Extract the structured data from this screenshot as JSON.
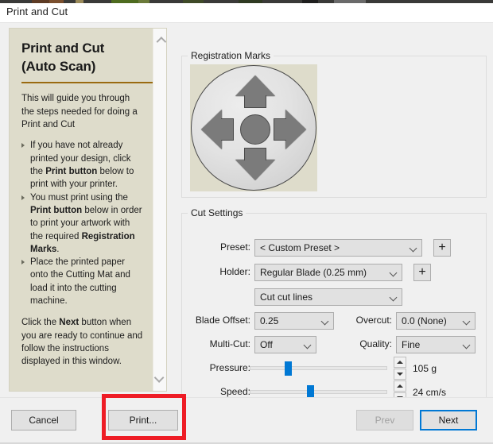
{
  "window": {
    "title": "Print and Cut"
  },
  "left_panel": {
    "heading": "Print and Cut\n(Auto Scan)",
    "heading_line1": "Print and Cut",
    "heading_line2": "(Auto Scan)",
    "intro": "This will guide you through the steps needed for doing a Print and Cut",
    "bullets": [
      {
        "pre": "If you have not already printed your design, click the ",
        "bold": "Print button",
        "post": " below to print with your printer."
      },
      {
        "pre": "You must print using the ",
        "bold": "Print button",
        "post": " below in order to print your artwork with the required ",
        "bold2": "Registration Marks",
        "post2": "."
      },
      {
        "pre": "Place the printed paper onto the Cutting Mat and load it into the cutting machine.",
        "bold": "",
        "post": ""
      }
    ],
    "footer_pre": "Click the ",
    "footer_bold": "Next",
    "footer_post": " button when you are ready to continue and follow the instructions displayed in this window.",
    "scrollbar": {
      "up": "scroll-up",
      "down": "scroll-down"
    },
    "bg_color": "#dedccb",
    "rule_color": "#9a6a10"
  },
  "registration": {
    "group_label": "Registration Marks",
    "image_alt": "registration-marks-dpad"
  },
  "cut_settings": {
    "group_label": "Cut Settings",
    "preset": {
      "label": "Preset:",
      "value": "< Custom Preset >",
      "add_label": "+"
    },
    "holder": {
      "label": "Holder:",
      "value": "Regular Blade (0.25 mm)",
      "add_label": "+"
    },
    "action": {
      "value": "Cut cut lines"
    },
    "blade_offset": {
      "label": "Blade Offset:",
      "value": "0.25"
    },
    "overcut": {
      "label": "Overcut:",
      "value": "0.0 (None)"
    },
    "multicut": {
      "label": "Multi-Cut:",
      "value": "Off"
    },
    "quality": {
      "label": "Quality:",
      "value": "Fine"
    },
    "pressure": {
      "label": "Pressure:",
      "value": "105 g",
      "percent": 27
    },
    "speed": {
      "label": "Speed:",
      "value": "24 cm/s",
      "percent": 44
    }
  },
  "footer": {
    "cancel": "Cancel",
    "print": "Print...",
    "prev": "Prev",
    "next": "Next",
    "highlight_color": "#ee1c25",
    "accent_color": "#0078d4"
  }
}
